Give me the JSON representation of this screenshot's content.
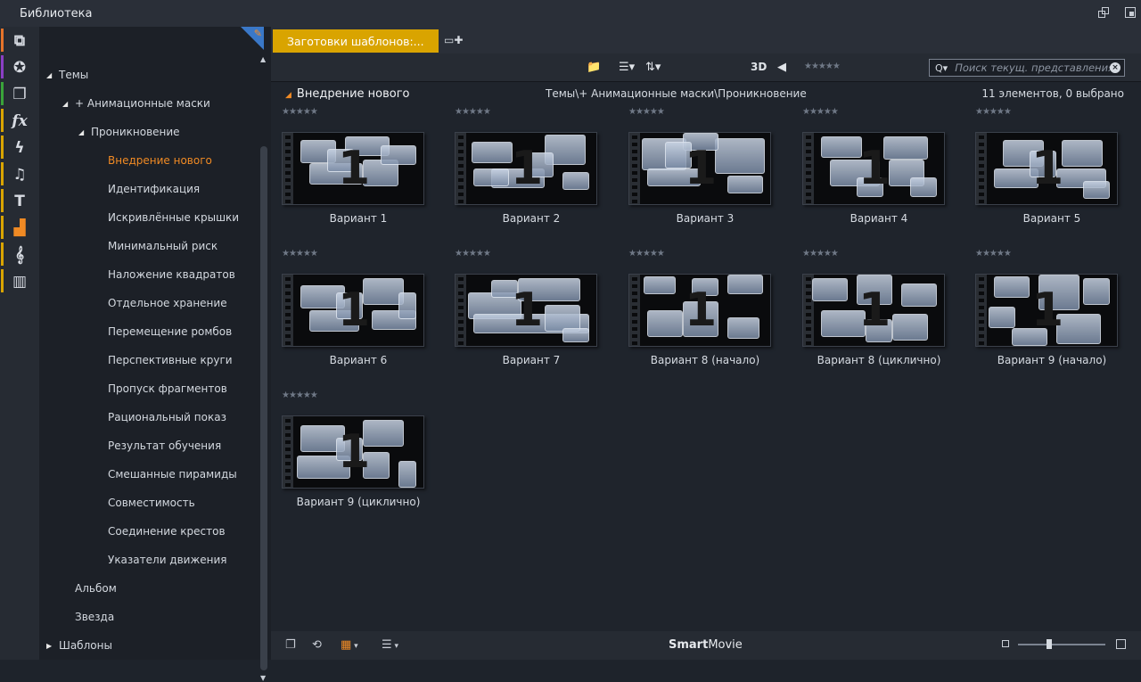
{
  "window": {
    "title": "Библиотека"
  },
  "iconbar": [
    {
      "icon": "box-icon",
      "glyph": "⧉",
      "stripe": "#e5732a"
    },
    {
      "icon": "film-reel-icon",
      "glyph": "✪",
      "stripe": "#8b3fc4"
    },
    {
      "icon": "stack-icon",
      "glyph": "❐",
      "stripe": "#3aa33a"
    },
    {
      "icon": "fx-icon",
      "glyph": "fx",
      "stripe": "#d9a400"
    },
    {
      "icon": "lightning-icon",
      "glyph": "ϟ",
      "stripe": "#d9a400"
    },
    {
      "icon": "music-note-icon",
      "glyph": "♫",
      "stripe": "#d9a400"
    },
    {
      "icon": "title-icon",
      "glyph": "T",
      "stripe": "#d9a400"
    },
    {
      "icon": "templates-icon",
      "glyph": "▟",
      "stripe": "#d9a400"
    },
    {
      "icon": "treble-clef-icon",
      "glyph": "𝄞",
      "stripe": "#d9a400"
    },
    {
      "icon": "piano-icon",
      "glyph": "▥",
      "stripe": "#d9a400"
    }
  ],
  "tree": {
    "items": [
      {
        "label": "Темы",
        "level": 0,
        "arrow": "◢"
      },
      {
        "label": "+ Анимационные маски",
        "level": 1,
        "arrow": "◢"
      },
      {
        "label": "Проникновение",
        "level": 2,
        "arrow": "◢"
      },
      {
        "label": "Внедрение нового",
        "level": 3,
        "arrow": "",
        "active": true
      },
      {
        "label": "Идентификация",
        "level": 3,
        "arrow": ""
      },
      {
        "label": "Искривлённые крышки",
        "level": 3,
        "arrow": ""
      },
      {
        "label": "Минимальный риск",
        "level": 3,
        "arrow": ""
      },
      {
        "label": "Наложение квадратов",
        "level": 3,
        "arrow": ""
      },
      {
        "label": "Отдельное хранение",
        "level": 3,
        "arrow": ""
      },
      {
        "label": "Перемещение ромбов",
        "level": 3,
        "arrow": ""
      },
      {
        "label": "Перспективные круги",
        "level": 3,
        "arrow": ""
      },
      {
        "label": "Пропуск фрагментов",
        "level": 3,
        "arrow": ""
      },
      {
        "label": "Рациональный показ",
        "level": 3,
        "arrow": ""
      },
      {
        "label": "Результат обучения",
        "level": 3,
        "arrow": ""
      },
      {
        "label": "Смешанные пирамиды",
        "level": 3,
        "arrow": ""
      },
      {
        "label": "Совместимость",
        "level": 3,
        "arrow": ""
      },
      {
        "label": "Соединение крестов",
        "level": 3,
        "arrow": ""
      },
      {
        "label": "Указатели движения",
        "level": 3,
        "arrow": ""
      },
      {
        "label": "Альбом",
        "level": 1.5,
        "arrow": ""
      },
      {
        "label": "Звезда",
        "level": 1.5,
        "arrow": ""
      },
      {
        "label": "Шаблоны",
        "level": 0,
        "arrow": "▶"
      }
    ]
  },
  "tab": {
    "label": "Заготовки шаблонов:..."
  },
  "toolbar": {
    "mode_3d": "3D",
    "search_placeholder": "Поиск текущ. представления"
  },
  "header": {
    "title": "Внедрение нового",
    "path": "Темы\\+ Анимационные маски\\Проникновение",
    "count": "11 элементов, 0 выбрано"
  },
  "items": [
    {
      "label": "Вариант 1"
    },
    {
      "label": "Вариант 2"
    },
    {
      "label": "Вариант 3"
    },
    {
      "label": "Вариант 4"
    },
    {
      "label": "Вариант 5"
    },
    {
      "label": "Вариант 6"
    },
    {
      "label": "Вариант 7"
    },
    {
      "label": "Вариант 8 (начало)"
    },
    {
      "label": "Вариант 8 (циклично)"
    },
    {
      "label": "Вариант 9 (начало)"
    },
    {
      "label": "Вариант 9 (циклично)"
    }
  ],
  "thumbnail_number": "1",
  "stars": "★★★★★",
  "bottombar": {
    "brand_bold": "Smart",
    "brand_rest": "Movie"
  },
  "zoom_level": 0.35,
  "colors": {
    "accent": "#f08a24",
    "tab": "#d9a400",
    "badge": "#3a78c8"
  }
}
